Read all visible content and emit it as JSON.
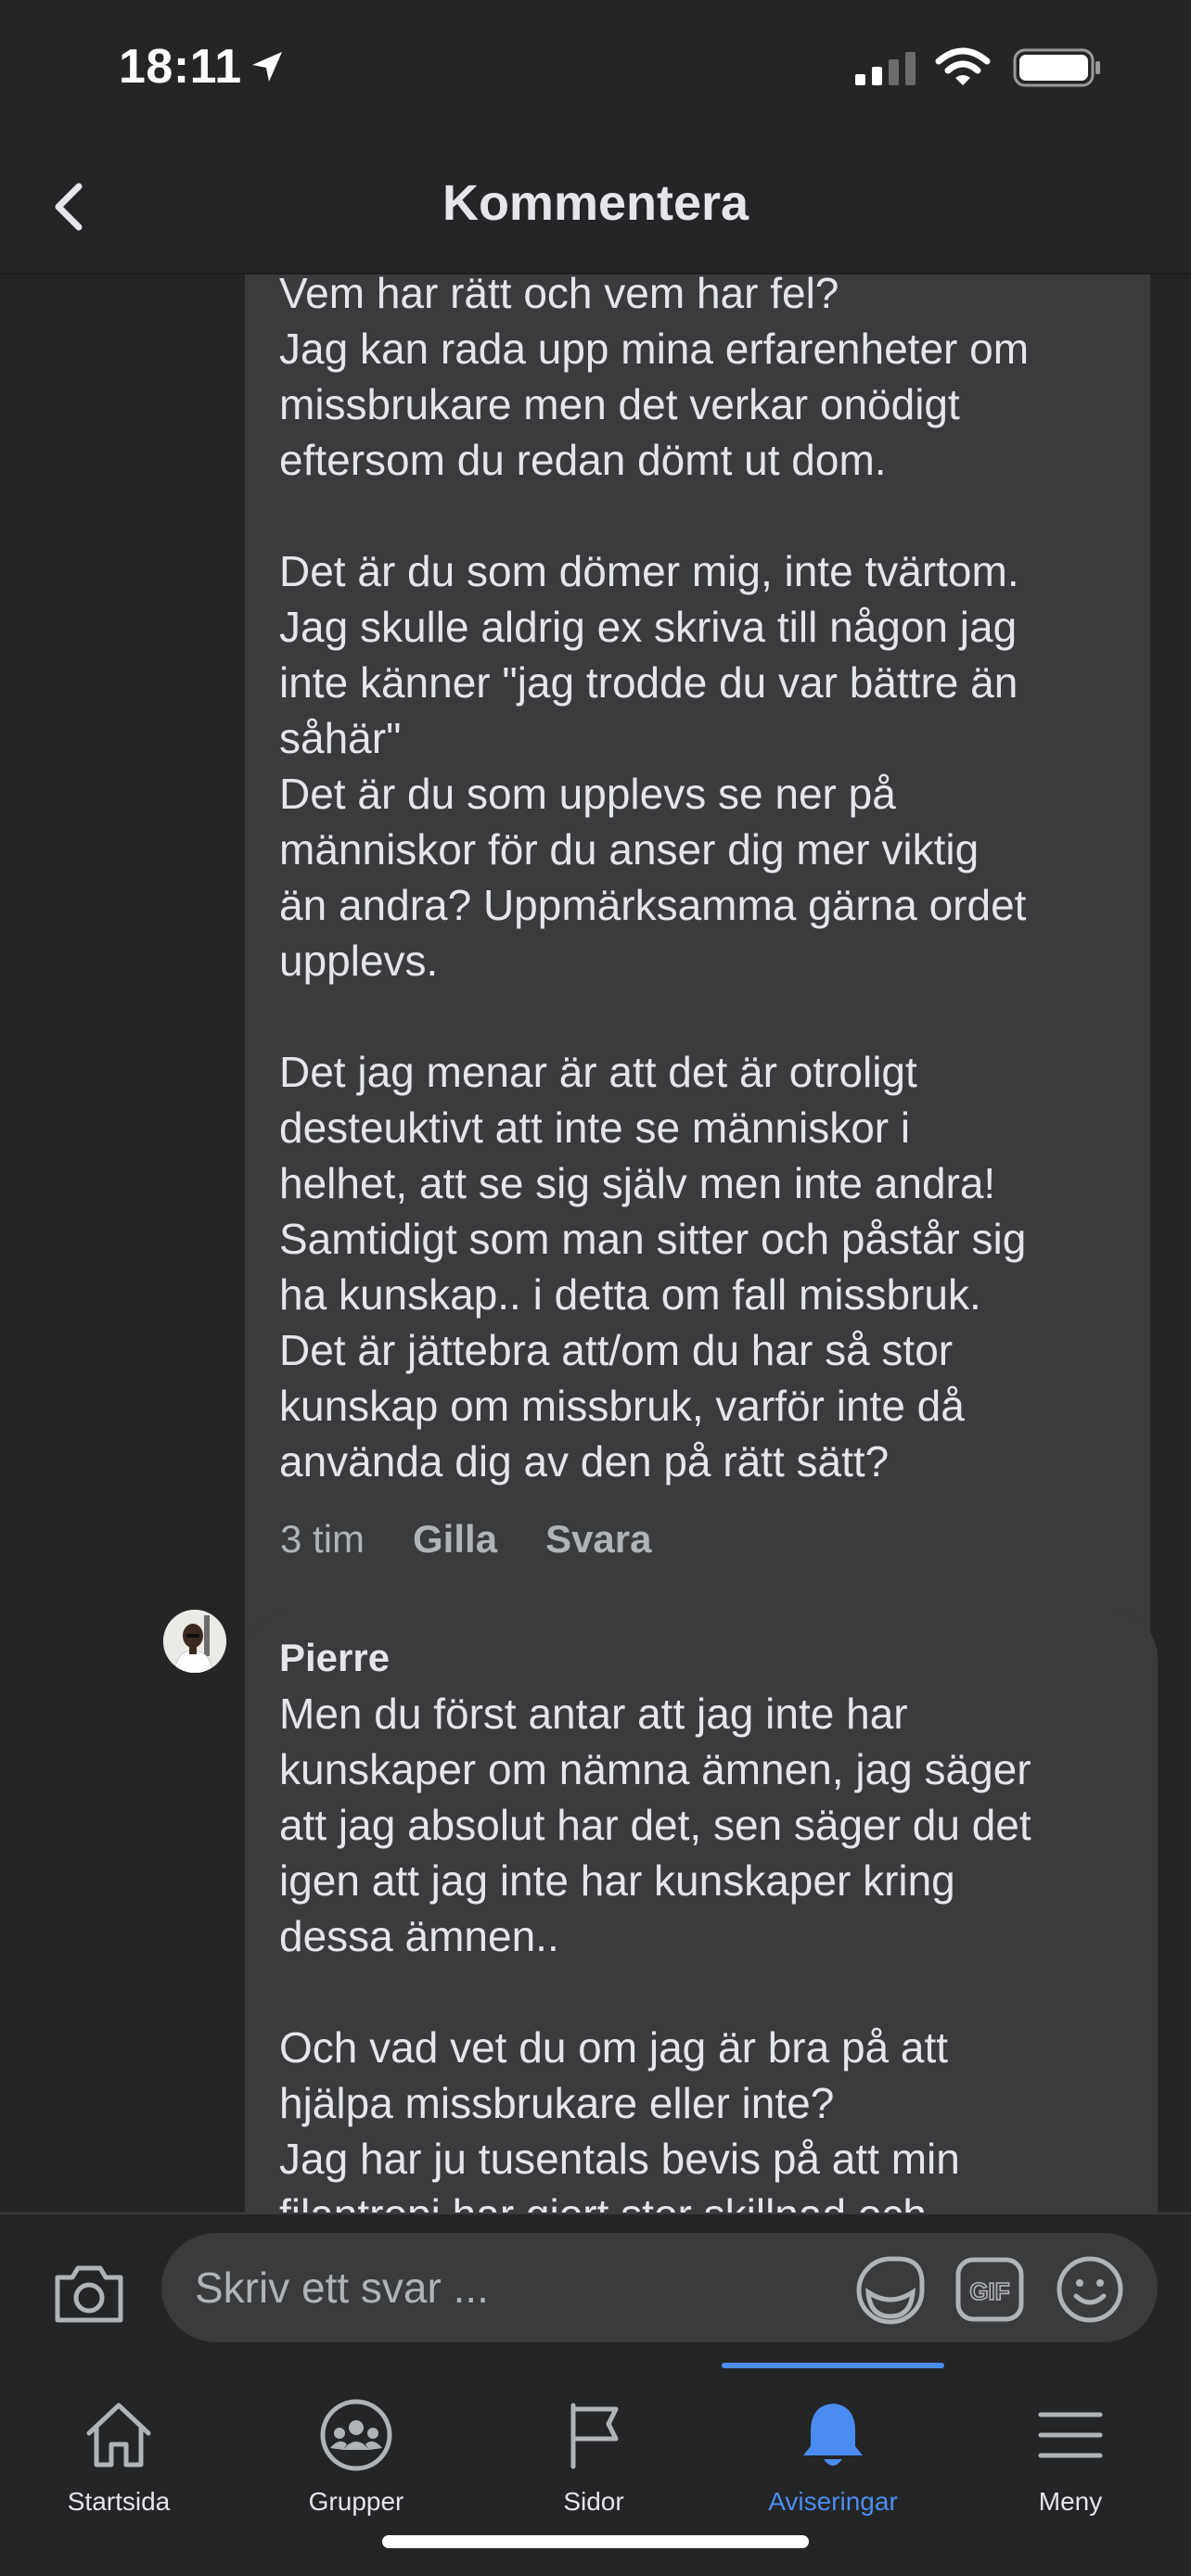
{
  "status_bar": {
    "time": "18:11",
    "icons": [
      "location-arrow-icon",
      "cellular-signal-icon",
      "wifi-icon",
      "battery-icon"
    ]
  },
  "header": {
    "title": "Kommentera",
    "back_icon": "chevron-left-icon"
  },
  "comments": [
    {
      "text": "Vem har rätt och vem har fel?\nJag kan rada upp mina erfarenheter om\nmissbrukare men det verkar onödigt\neftersom du redan dömt ut dom.\n\nDet är du som dömer mig, inte tvärtom.\nJag skulle aldrig ex skriva till någon jag\ninte känner \"jag trodde du var bättre än\nsåhär\"\nDet är du som upplevs se ner på\nmänniskor för du anser dig mer viktig\nän andra? Uppmärksamma gärna ordet\nupplevs.\n\nDet jag menar är att det är otroligt\ndesteuktivt att inte se människor i\nhelhet, att se sig själv men inte andra!\nSamtidigt som man sitter och påstår sig\nha kunskap.. i detta om fall missbruk.\nDet är jättebra att/om du har så stor\nkunskap om missbruk, varför inte då\nanvända dig av den på rätt sätt?",
      "time": "3 tim",
      "like_label": "Gilla",
      "reply_label": "Svara"
    },
    {
      "author": "Pierre",
      "text": "Men du först antar att jag inte har\nkunskaper om nämna ämnen, jag säger\natt jag absolut har det, sen säger du det\nigen att jag inte har kunskaper kring\ndessa ämnen..\n\nOch vad vet du om jag är bra på att\nhjälpa missbrukare eller inte?\nJag har ju tusentals bevis på att min\nfilantropi har gjort stor skillnad och"
    }
  ],
  "composer": {
    "placeholder": "Skriv ett svar ...",
    "icons": [
      "camera-icon",
      "sticker-icon",
      "gif-icon",
      "emoji-icon"
    ]
  },
  "tab_bar": {
    "active": "Aviseringar",
    "tabs": [
      {
        "label": "Startsida",
        "icon": "home-icon"
      },
      {
        "label": "Grupper",
        "icon": "groups-icon"
      },
      {
        "label": "Sidor",
        "icon": "flag-icon"
      },
      {
        "label": "Aviseringar",
        "icon": "bell-icon"
      },
      {
        "label": "Meny",
        "icon": "hamburger-menu-icon"
      }
    ]
  },
  "colors": {
    "background": "#242526",
    "bubble": "#3a3b3c",
    "text": "#e4e6eb",
    "secondary_text": "#b0b3b8",
    "accent": "#4b8cf0"
  }
}
